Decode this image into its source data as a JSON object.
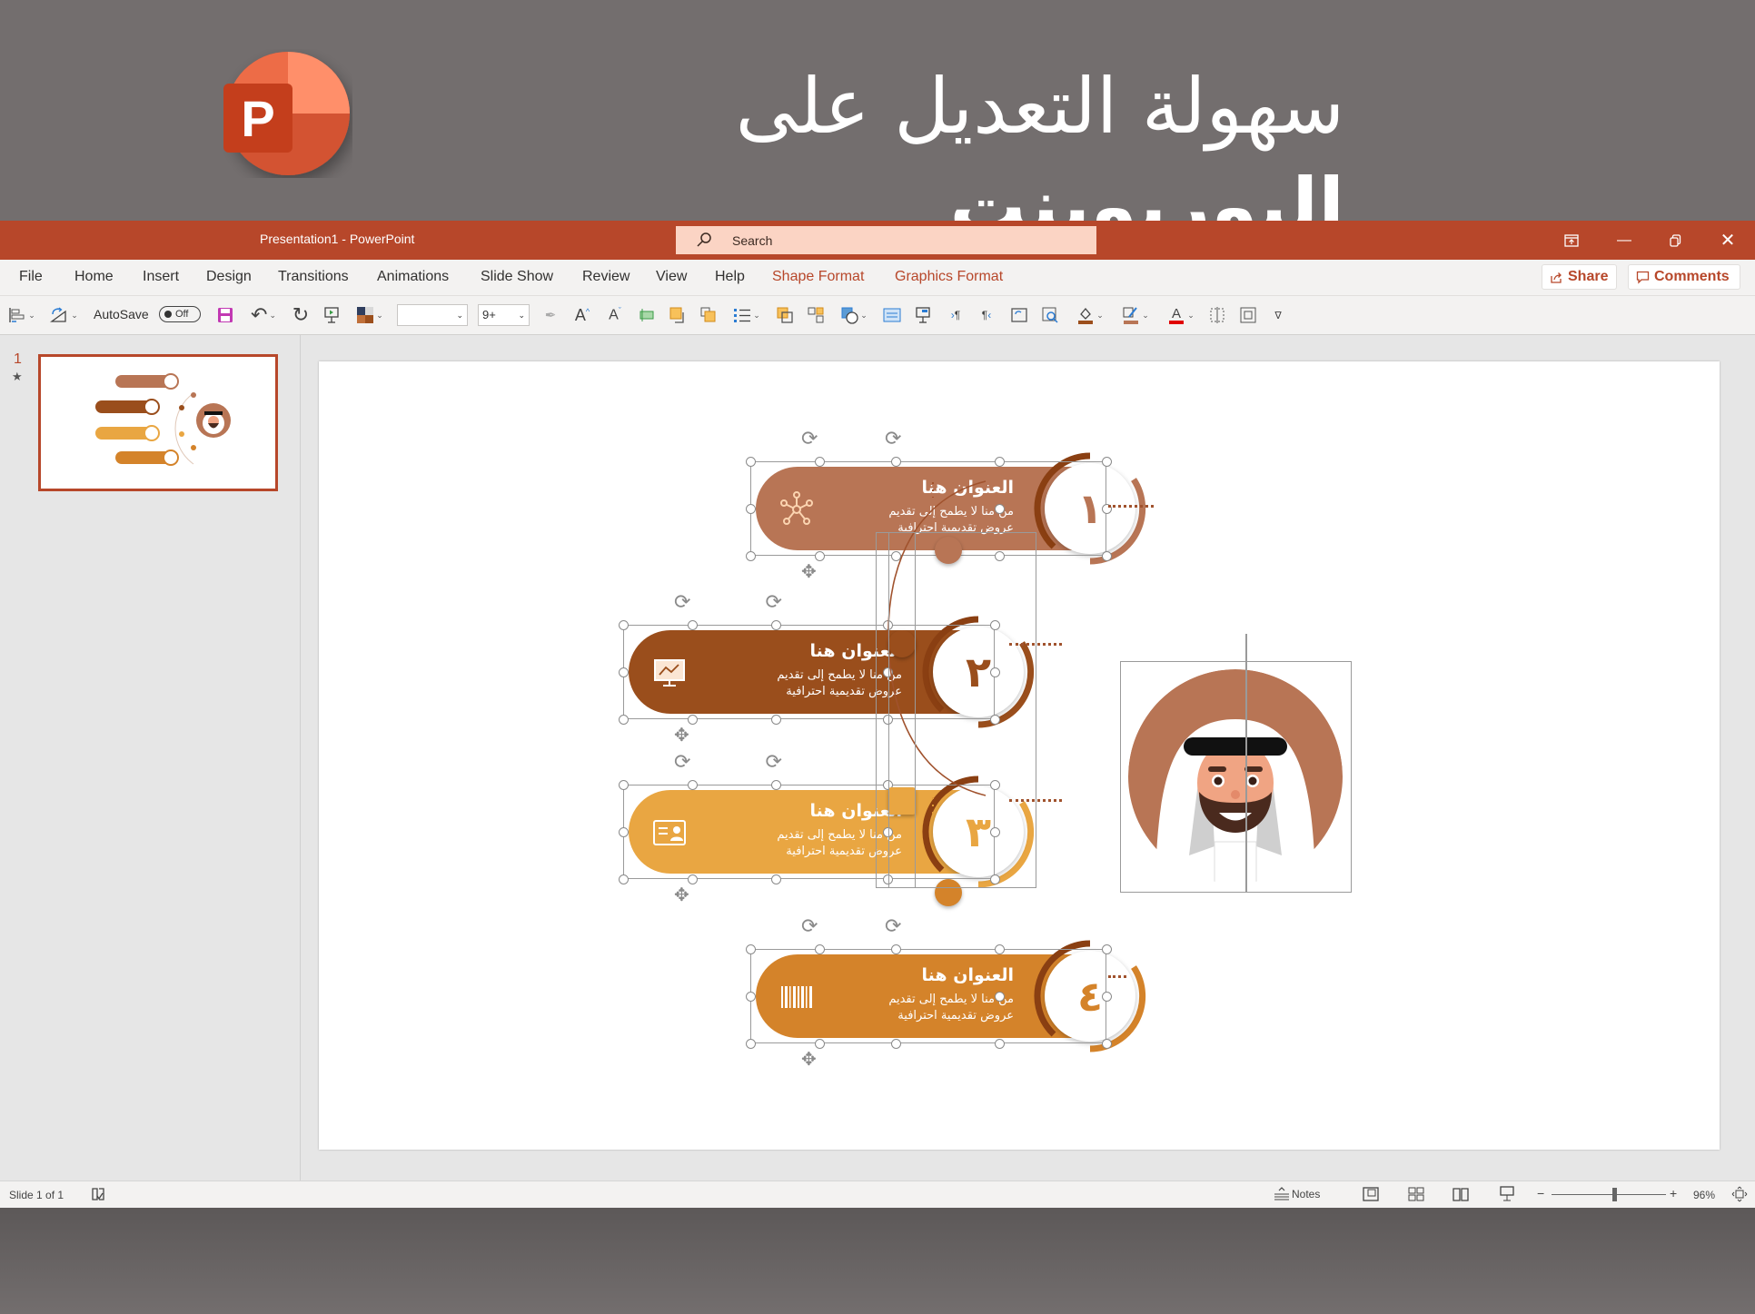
{
  "promo": {
    "title_regular": "سهولة التعديل على ",
    "title_bold": "البوربوينت",
    "logo_letter": "P"
  },
  "window": {
    "document_title": "Presentation1  -  PowerPoint",
    "search_label": "Search",
    "controls": [
      "ribbon-display",
      "minimize",
      "restore",
      "close"
    ]
  },
  "menu": {
    "items": [
      "File",
      "Home",
      "Insert",
      "Design",
      "Transitions",
      "Animations",
      "Slide Show",
      "Review",
      "View",
      "Help",
      "Shape Format",
      "Graphics Format"
    ],
    "accent_items": [
      "Shape Format",
      "Graphics Format"
    ],
    "share_label": "Share",
    "comments_label": "Comments"
  },
  "toolbar": {
    "autosave_label": "AutoSave",
    "autosave_state": "Off",
    "font_name_value": "",
    "font_size_value": "9+"
  },
  "slides_pane": {
    "slide_number": "1",
    "animation_marker": "★"
  },
  "slide": {
    "items": [
      {
        "number": "١",
        "title": "العنوان هنا",
        "desc_line1": "من منا لا يطمح إلى تقديم",
        "desc_line2": "عروض تقديمية احترافية",
        "color": "#b87555",
        "icon": "network-icon"
      },
      {
        "number": "٢",
        "title": "العنوان هنا",
        "desc_line1": "من منا لا يطمح إلى تقديم",
        "desc_line2": "عروض تقديمية احترافية",
        "color": "#9a4e1c",
        "icon": "presentation-board-icon"
      },
      {
        "number": "٣",
        "title": "العنوان هنا",
        "desc_line1": "من منا لا يطمح إلى تقديم",
        "desc_line2": "عروض تقديمية احترافية",
        "color": "#e9a642",
        "icon": "id-card-icon"
      },
      {
        "number": "٤",
        "title": "العنوان هنا",
        "desc_line1": "من منا لا يطمح إلى تقديم",
        "desc_line2": "عروض تقديمية احترافية",
        "color": "#d4832a",
        "icon": "barcode-icon"
      }
    ],
    "portrait_ring_color": "#b87555"
  },
  "status": {
    "slide_indicator": "Slide 1 of 1",
    "notes_label": "Notes",
    "zoom_percent": "96%",
    "zoom_level": 0.55
  },
  "colors": {
    "accent": "#b7472a",
    "search_bg": "#fbd4c4",
    "ribbon_bg": "#f3f2f1"
  }
}
